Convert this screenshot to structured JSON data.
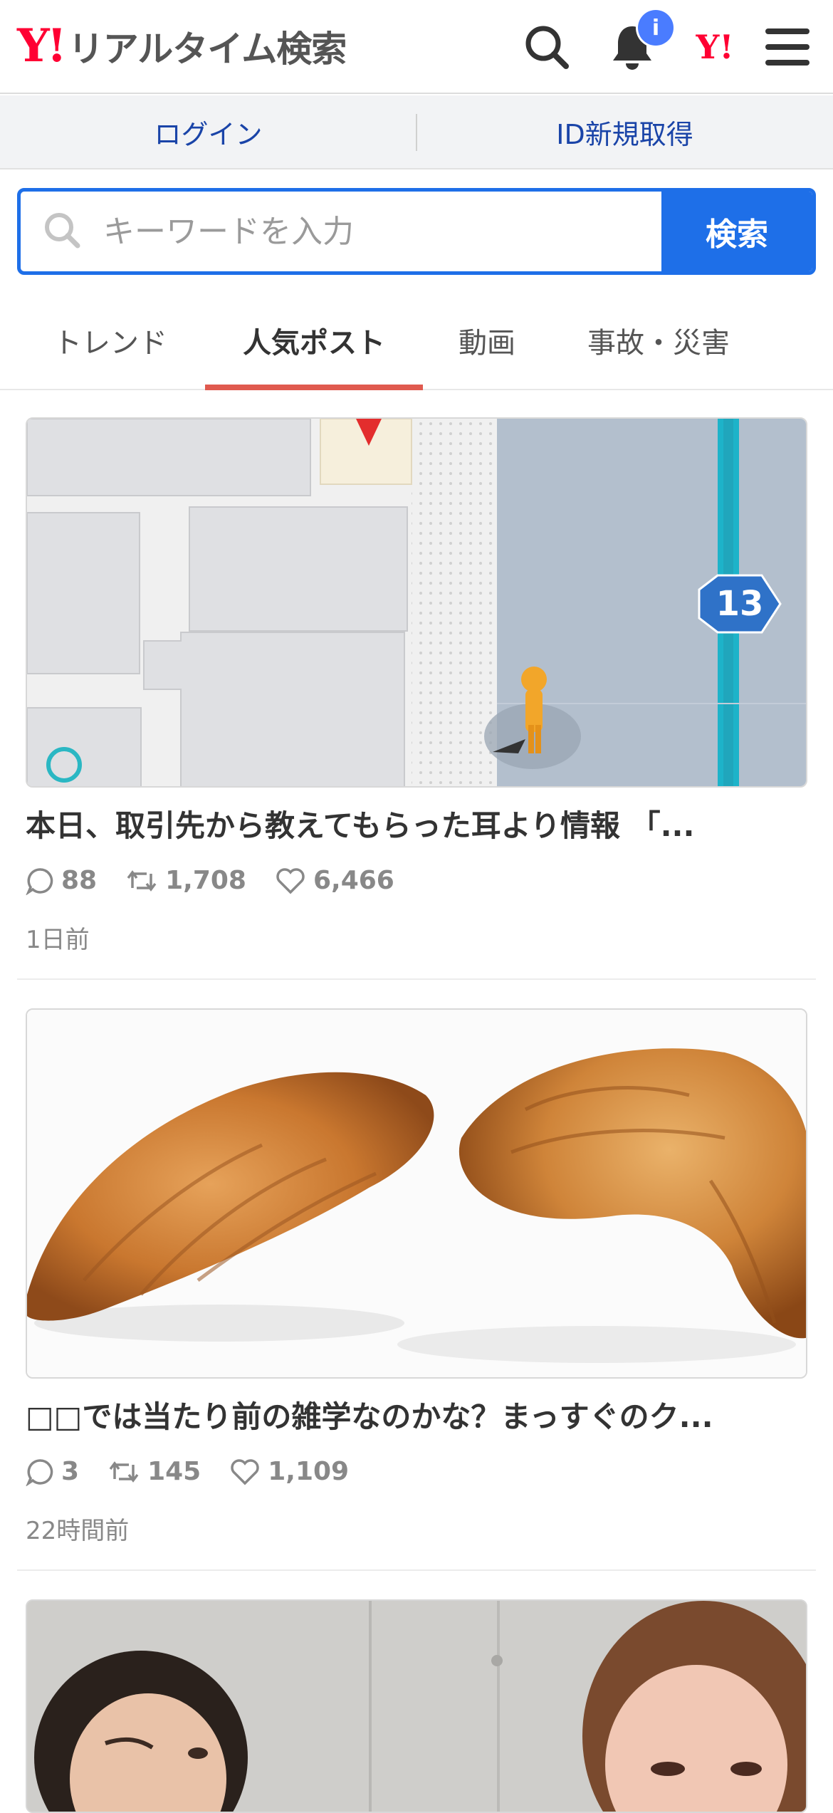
{
  "header": {
    "logo_mark": "Y!",
    "logo_text": "リアルタイム検索",
    "notification_badge": "i",
    "yjapan_icon_text": "Y!"
  },
  "login_bar": {
    "login_label": "ログイン",
    "register_label": "ID新規取得"
  },
  "search": {
    "placeholder": "キーワードを入力",
    "button_label": "検索"
  },
  "tabs": [
    {
      "label": "トレンド"
    },
    {
      "label": "人気ポスト"
    },
    {
      "label": "動画"
    },
    {
      "label": "事故・災害"
    }
  ],
  "posts": [
    {
      "image": "map-screenshot",
      "map_route_label": "13",
      "title": "本日、取引先から教えてもらった耳より情報 「...",
      "replies": "88",
      "reposts": "1,708",
      "likes": "6,466",
      "time": "1日前"
    },
    {
      "image": "croissants-photo",
      "title": "□□では当たり前の雑学なのかな？まっすぐのク...",
      "replies": "3",
      "reposts": "145",
      "likes": "1,109",
      "time": "22時間前"
    },
    {
      "image": "two-women-photo"
    }
  ],
  "colors": {
    "brand_red": "#ff0033",
    "primary_blue": "#1e6fe8",
    "link_blue": "#1a44a8",
    "tab_indicator": "#e05a4f",
    "badge_blue": "#4a7cff"
  }
}
